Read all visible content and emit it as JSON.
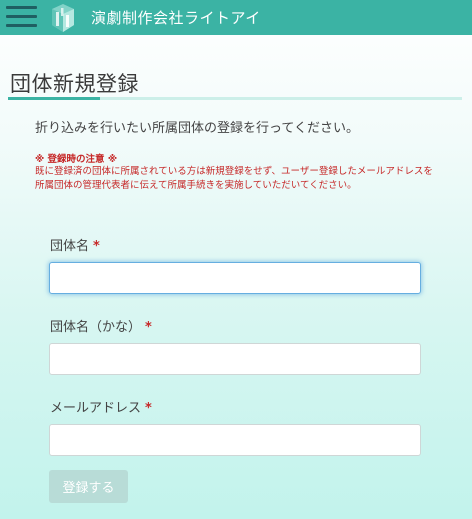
{
  "header": {
    "brand": "演劇制作会社ライトアイ",
    "menu_icon": "hamburger-icon",
    "logo_icon": "company-logo-icon",
    "background_color": "#3bb3a4"
  },
  "page": {
    "title": "団体新規登録",
    "intro": "折り込みを行いたい所属団体の登録を行ってください。",
    "notice_title": "※ 登録時の注意 ※",
    "notice_body": "既に登録済の団体に所属されている方は新規登録をせず、ユーザー登録したメールアドレスを所属団体の管理代表者に伝えて所属手続きを実施していただいてください。"
  },
  "form": {
    "group_name": {
      "label": "団体名",
      "required_mark": "*",
      "value": "",
      "placeholder": ""
    },
    "group_kana": {
      "label": "団体名（かな）",
      "required_mark": "*",
      "value": "",
      "placeholder": ""
    },
    "email": {
      "label": "メールアドレス",
      "required_mark": "*",
      "value": "",
      "placeholder": ""
    },
    "submit_label": "登録する"
  },
  "colors": {
    "accent": "#3bb3a4",
    "required": "#c62828",
    "disabled_button": "#b8dcd7"
  }
}
